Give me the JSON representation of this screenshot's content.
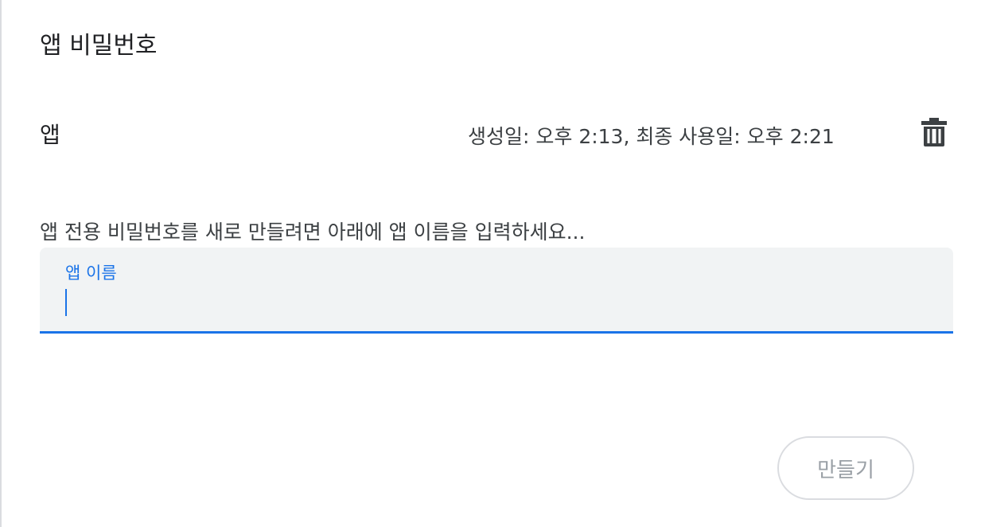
{
  "section": {
    "title": "앱 비밀번호"
  },
  "app_passwords": [
    {
      "name": "앱",
      "meta": "생성일: 오후 2:13, 최종 사용일: 오후 2:21",
      "delete_icon": "trash-icon"
    }
  ],
  "create": {
    "instructions": "앱 전용 비밀번호를 새로 만들려면 아래에 앱 이름을 입력하세요...",
    "field_label": "앱 이름",
    "field_value": "",
    "button_label": "만들기"
  },
  "colors": {
    "accent": "#1a73e8",
    "field_background": "#f1f3f4",
    "text_primary": "#202124",
    "text_secondary": "#3c4043",
    "disabled_text": "#9aa0a6",
    "border": "#dadce0"
  }
}
